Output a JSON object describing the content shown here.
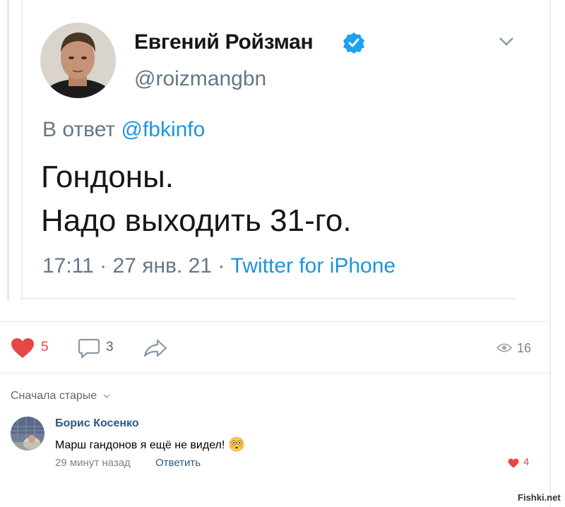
{
  "tweet": {
    "author_name": "Евгений Ройзман",
    "handle": "@roizmangbn",
    "reply_prefix": "В ответ",
    "reply_mention": "@fbkinfo",
    "text_line1": "Гондоны.",
    "text_line2": "Надо выходить 31-го.",
    "time_date": "17:11 · 27 янв. 21 · ",
    "source": "Twitter for iPhone",
    "colors": {
      "link": "#1b95e0",
      "secondary": "#657786",
      "verified": "#1da1f2"
    },
    "icons": [
      "verified-badge-icon",
      "chevron-down-icon"
    ]
  },
  "post_actions": {
    "likes": "5",
    "comments": "3",
    "views": "16",
    "icons": [
      "heart-icon",
      "comment-icon",
      "share-icon",
      "eye-icon"
    ],
    "like_color": "#e64646"
  },
  "comments": {
    "sort_label": "Сначала старые",
    "items": [
      {
        "author": "Борис Косенко",
        "text": "Марш гандонов я ещё не видел!",
        "time": "29 минут назад",
        "reply_label": "Ответить",
        "likes": "4",
        "emoji": "flushed-face-emoji"
      }
    ]
  },
  "watermark": "Fishki.net"
}
